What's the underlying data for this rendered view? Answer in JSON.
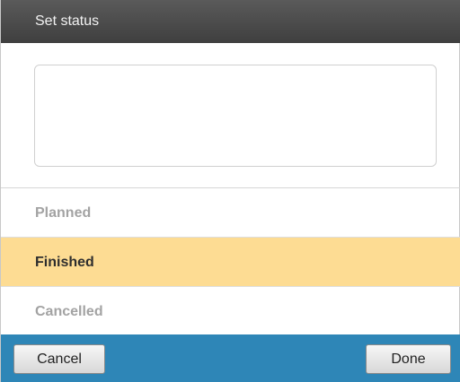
{
  "dialog": {
    "title": "Set status",
    "note": {
      "value": "",
      "placeholder": ""
    },
    "options": [
      {
        "label": "Planned",
        "selected": false
      },
      {
        "label": "Finished",
        "selected": true
      },
      {
        "label": "Cancelled",
        "selected": false
      }
    ],
    "buttons": {
      "cancel_label": "Cancel",
      "done_label": "Done"
    }
  },
  "colors": {
    "header_bg": "#474747",
    "selected_bg": "#fddc93",
    "footer_bg": "#2e86b7",
    "muted_text": "#a3a3a3"
  }
}
